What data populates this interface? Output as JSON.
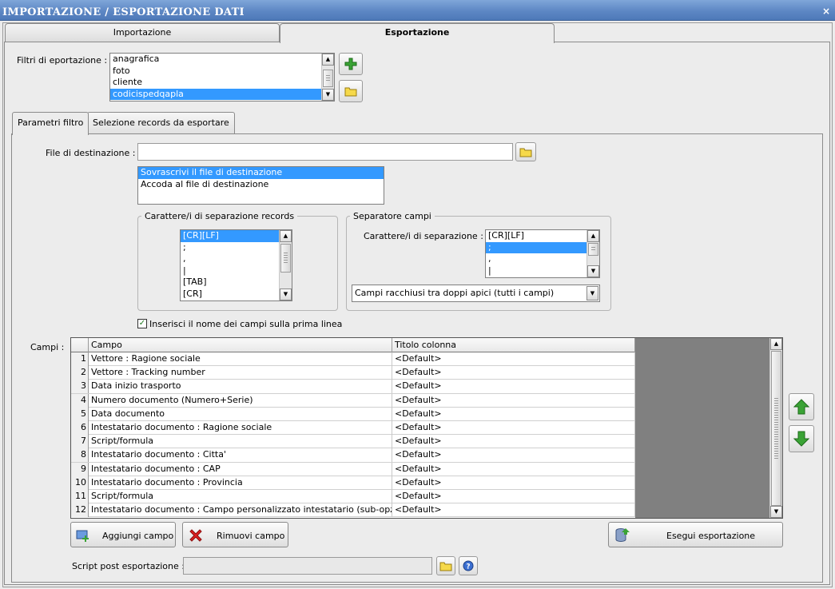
{
  "window": {
    "title": "IMPORTAZIONE / ESPORTAZIONE DATI",
    "close": "×"
  },
  "tabs": [
    {
      "label": "Importazione"
    },
    {
      "label": "Esportazione"
    }
  ],
  "filters": {
    "label": "Filtri di eportazione :",
    "items": [
      "anagrafica",
      "foto",
      "cliente",
      "codicispedqapla"
    ],
    "selected": 3
  },
  "subtabs": [
    {
      "label": "Parametri filtro"
    },
    {
      "label": "Selezione records da esportare"
    }
  ],
  "destination": {
    "label": "File di destinazione :",
    "value": "",
    "options": [
      "Sovrascrivi il file di destinazione",
      "Accoda al file di destinazione"
    ],
    "selected": 0
  },
  "record_separator": {
    "legend": "Carattere/i di separazione records",
    "items": [
      "[CR][LF]",
      ";",
      ",",
      "|",
      "[TAB]",
      "[CR]"
    ],
    "selected": 0
  },
  "field_separator": {
    "legend": "Separatore campi",
    "label": "Carattere/i di separazione :",
    "items": [
      "[CR][LF]",
      ";",
      ",",
      "|"
    ],
    "selected": 1,
    "quote_mode": "Campi racchiusi tra doppi apici (tutti i campi)"
  },
  "header_checkbox": {
    "label": "Inserisci il nome dei campi sulla prima linea",
    "checked": true,
    "mark": "✓"
  },
  "fields": {
    "label": "Campi :",
    "columns": [
      "Campo",
      "Titolo colonna"
    ],
    "rows": [
      {
        "n": "1",
        "campo": "Vettore : Ragione sociale",
        "titolo": "<Default>"
      },
      {
        "n": "2",
        "campo": "Vettore : Tracking number",
        "titolo": "<Default>"
      },
      {
        "n": "3",
        "campo": "Data inizio trasporto",
        "titolo": "<Default>"
      },
      {
        "n": "4",
        "campo": "Numero documento (Numero+Serie)",
        "titolo": "<Default>"
      },
      {
        "n": "5",
        "campo": "Data documento",
        "titolo": "<Default>"
      },
      {
        "n": "6",
        "campo": "Intestatario documento : Ragione sociale",
        "titolo": "<Default>"
      },
      {
        "n": "7",
        "campo": "Script/formula",
        "titolo": "<Default>"
      },
      {
        "n": "8",
        "campo": "Intestatario documento : Citta'",
        "titolo": "<Default>"
      },
      {
        "n": "9",
        "campo": "Intestatario documento : CAP",
        "titolo": "<Default>"
      },
      {
        "n": "10",
        "campo": "Intestatario documento : Provincia",
        "titolo": "<Default>"
      },
      {
        "n": "11",
        "campo": "Script/formula",
        "titolo": "<Default>"
      },
      {
        "n": "12",
        "campo": "Intestatario documento : Campo personalizzato intestatario (sub-opzi...",
        "titolo": "<Default>"
      }
    ]
  },
  "buttons": {
    "add_field": "Aggiungi campo",
    "remove_field": "Rimuovi campo",
    "run_export": "Esegui esportazione"
  },
  "post_script": {
    "label": "Script post esportazione :",
    "value": ""
  },
  "colors": {
    "accent": "#3399ff",
    "title_bar": "#5d87c4",
    "green": "#3aa335",
    "red": "#e02020"
  }
}
